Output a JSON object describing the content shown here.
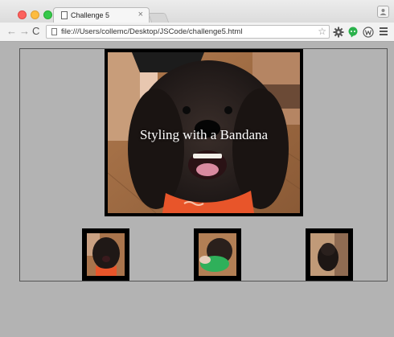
{
  "browser": {
    "tab_title": "Challenge 5",
    "tab_close": "×",
    "url": "file:///Users/collemc/Desktop/JSCode/challenge5.html",
    "nav": {
      "back": "←",
      "forward": "→",
      "reload": "C"
    },
    "star": "☆"
  },
  "page": {
    "main_caption": "Styling with a Bandana",
    "thumbnails": [
      {
        "name": "thumbnail-dog-bandana"
      },
      {
        "name": "thumbnail-dog-green-toy"
      },
      {
        "name": "thumbnail-dog-sitting"
      }
    ]
  },
  "colors": {
    "page_background": "#b3b3b3",
    "frame": "#000000",
    "bandana": "#e8552a",
    "caption": "#ffffff"
  }
}
